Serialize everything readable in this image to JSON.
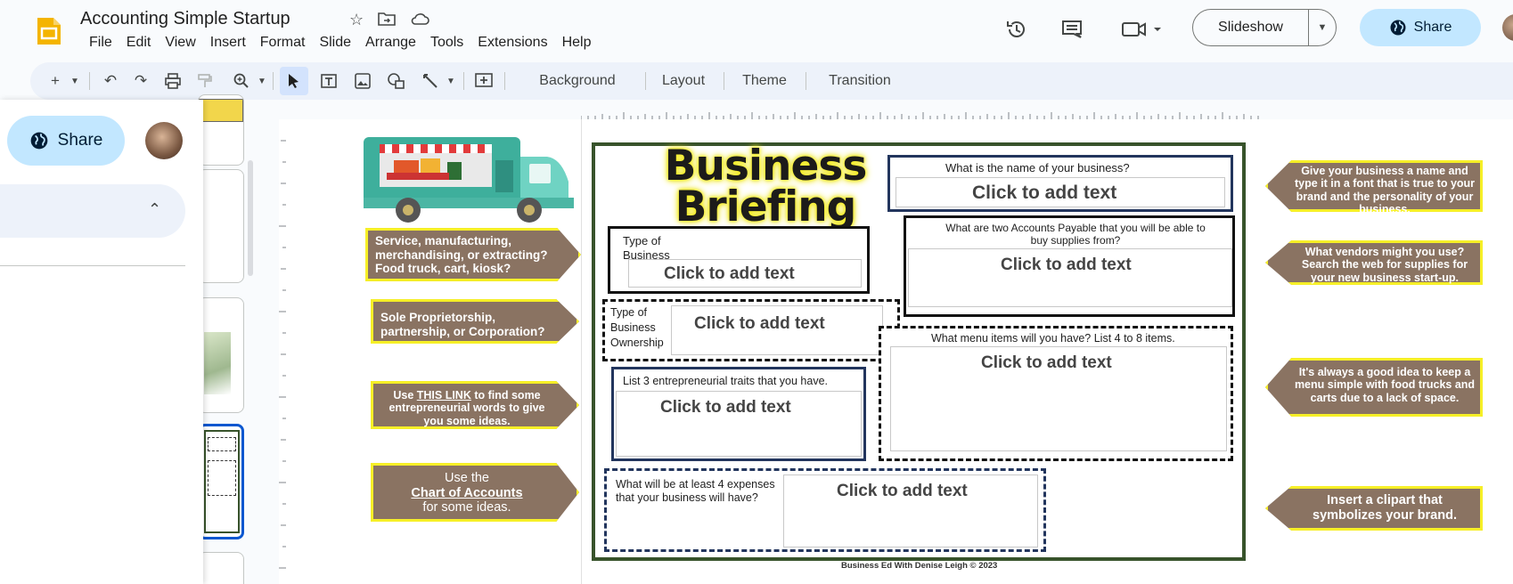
{
  "app": {
    "doc_title": "Accounting Simple Startup",
    "menu": [
      "File",
      "Edit",
      "View",
      "Insert",
      "Format",
      "Slide",
      "Arrange",
      "Tools",
      "Extensions",
      "Help"
    ],
    "slideshow_label": "Slideshow",
    "share_label": "Share"
  },
  "toolbar": {
    "background_label": "Background",
    "layout_label": "Layout",
    "theme_label": "Theme",
    "transition_label": "Transition"
  },
  "left_panel": {
    "share_label": "Share"
  },
  "slide": {
    "title_line1": "Business",
    "title_line2": "Briefing",
    "left_callouts": [
      "Service, manufacturing, merchandising, or extracting? Food truck, cart, kiosk?",
      "Sole Proprietorship, partnership, or Corporation?"
    ],
    "link_callout": {
      "prefix": "Use ",
      "link": "THIS LINK",
      "suffix": " to find some entrepreneurial words to give you some ideas."
    },
    "chart_callout": {
      "line1": "Use the",
      "link": "Chart of Accounts",
      "line3": "for some ideas."
    },
    "right_callouts": [
      "Give your business a name and type it in a font that is true to your brand and the personality of your business.",
      "What vendors might you use? Search the web for supplies for your new business start-up.",
      "It's always a good idea to keep a menu simple with food trucks and carts due to a lack of space.",
      "Insert a clipart that symbolizes your brand."
    ],
    "placeholder": "Click to add text",
    "questions": {
      "name": "What is the name of your business?",
      "type": "Type of Business",
      "payable": "What are two Accounts Payable that you will be able to buy supplies from?",
      "ownership": "Type of Business Ownership",
      "menu": "What menu items will you have? List 4 to 8 items.",
      "traits": "List 3 entrepreneurial traits that you have.",
      "expenses": "What will be at least  4 expenses that your business will have?"
    },
    "footer": "Business Ed With Denise Leigh © 2023"
  },
  "colors": {
    "callout_fill": "#8a7362",
    "callout_border": "#f6ef27",
    "frame_green": "#38532b",
    "share_blue": "#c2e7ff",
    "toolbar_bg": "#edf2fa"
  }
}
